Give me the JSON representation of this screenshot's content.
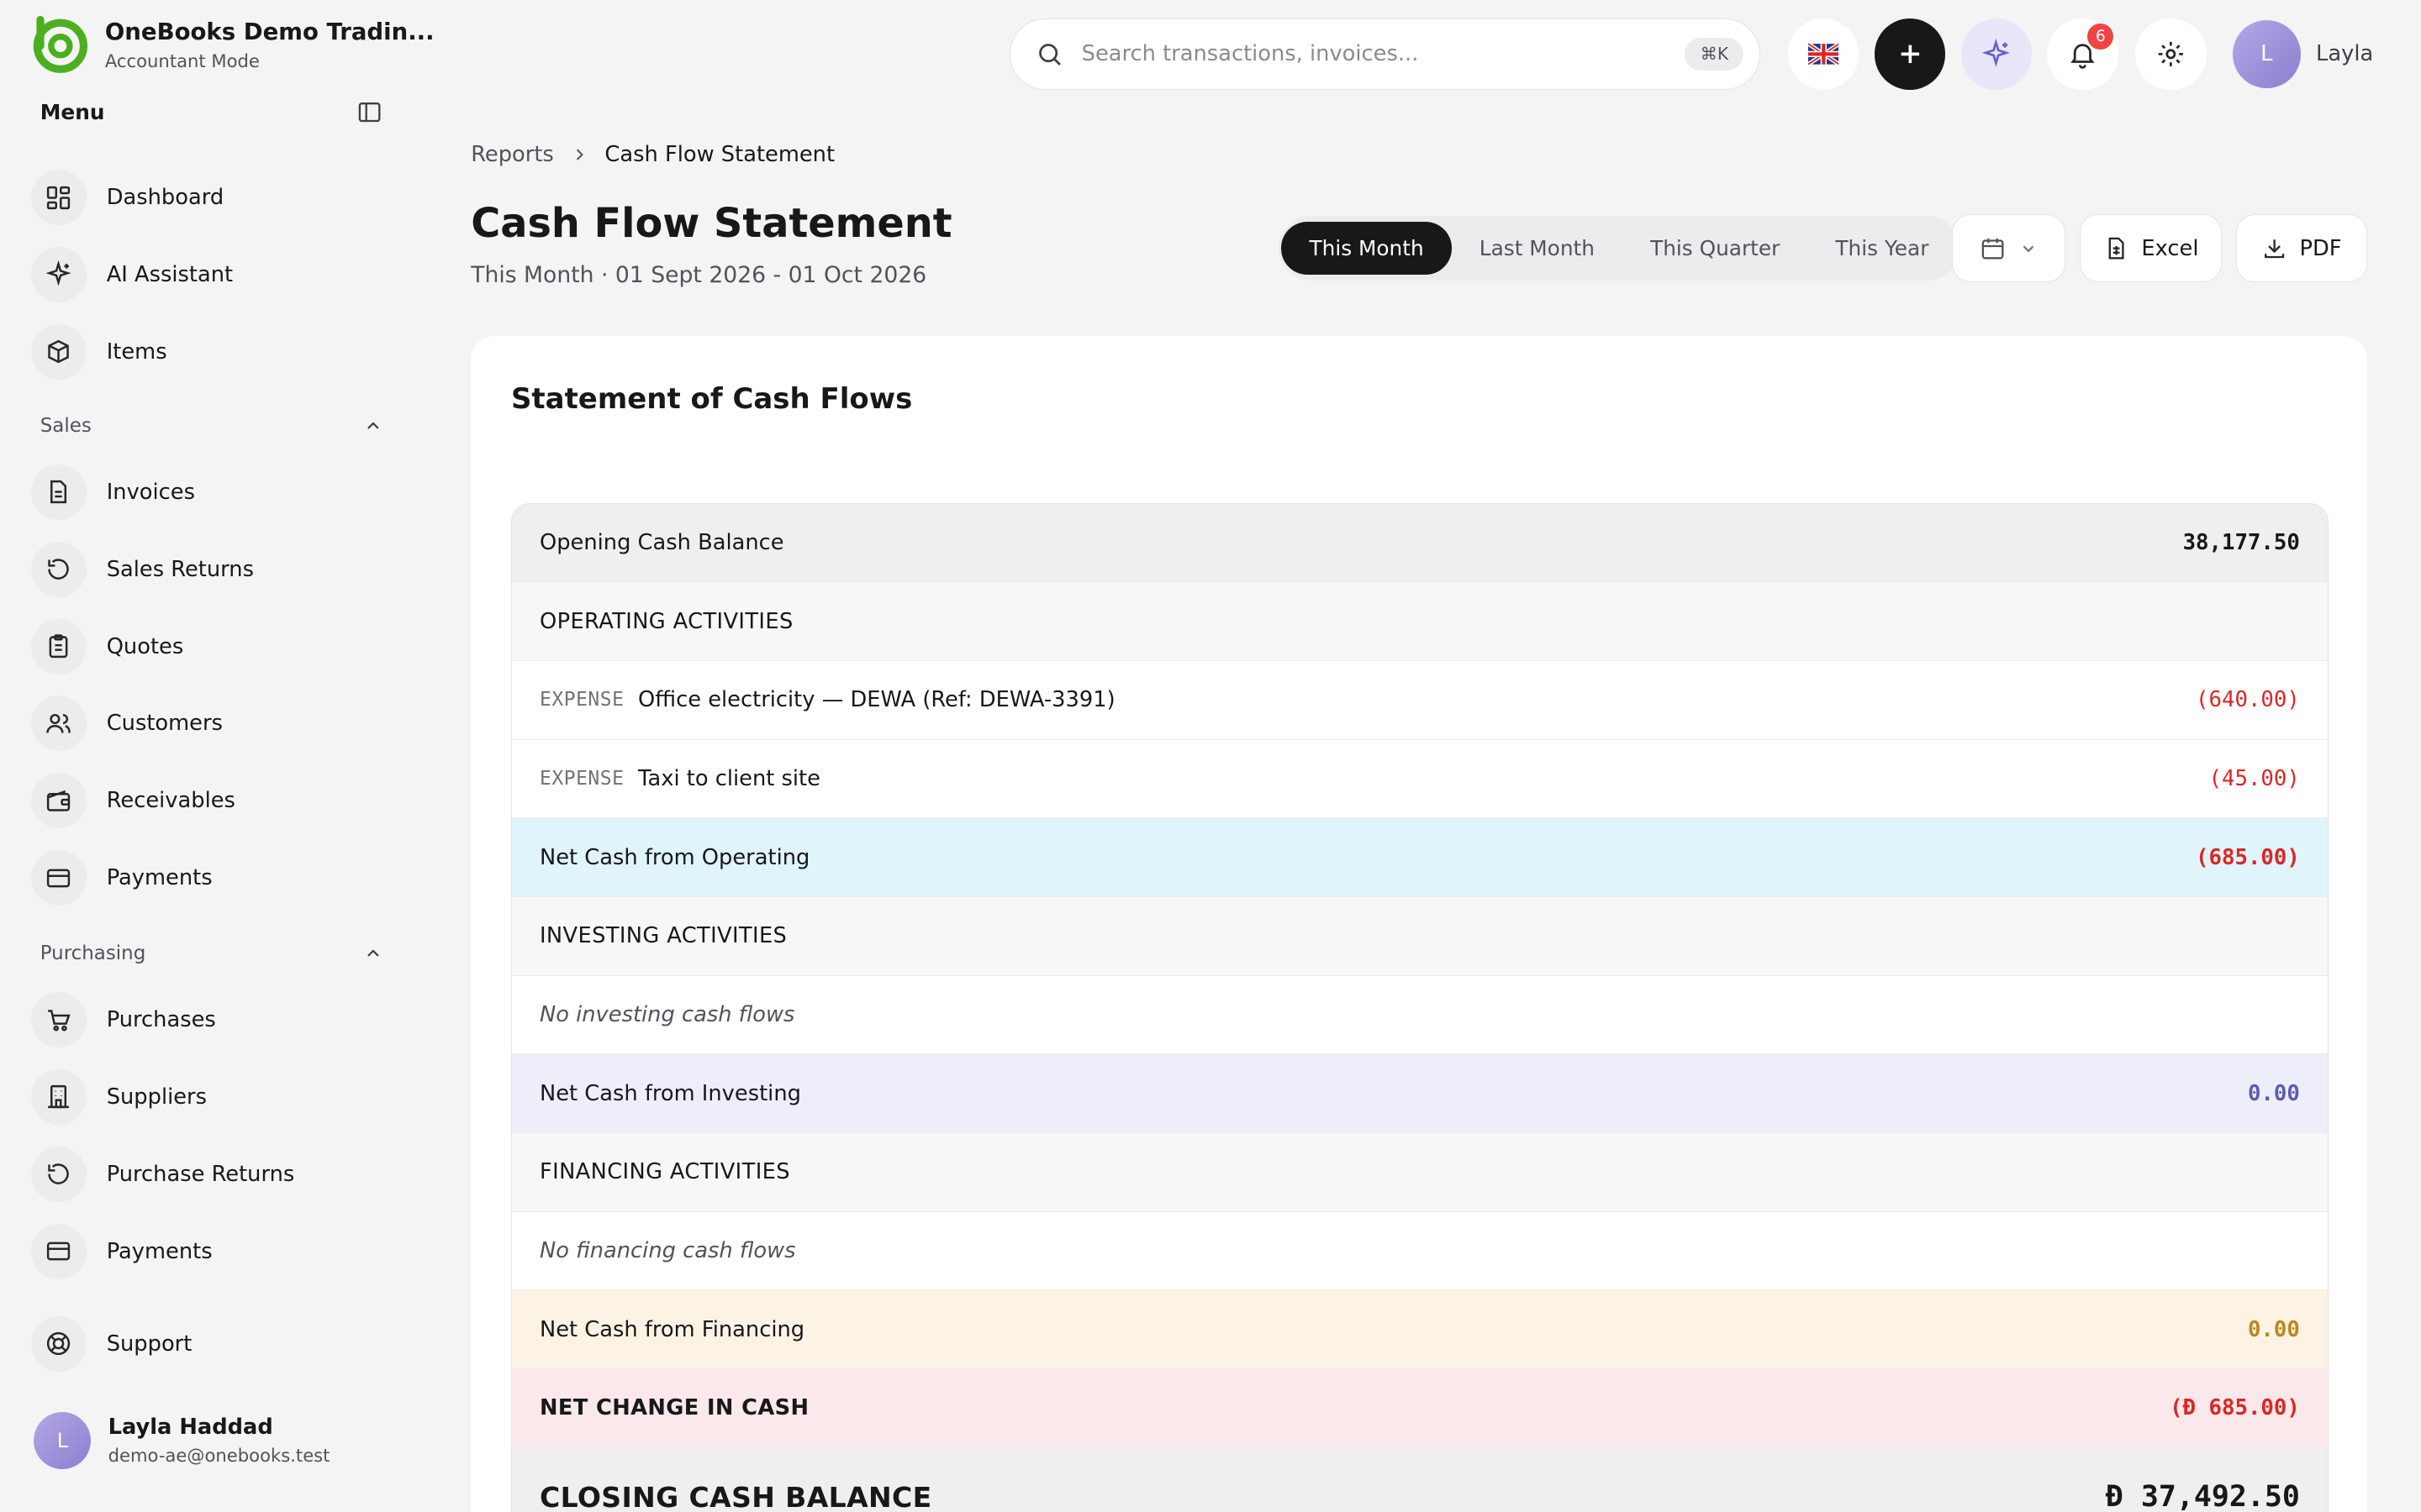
{
  "app": {
    "name": "OneBooks Demo Tradin...",
    "mode": "Accountant Mode"
  },
  "sidebar": {
    "menu_title": "Menu",
    "top_items": [
      {
        "label": "Dashboard",
        "icon": "dashboard-icon"
      },
      {
        "label": "AI Assistant",
        "icon": "sparkles-icon"
      },
      {
        "label": "Items",
        "icon": "box-icon"
      }
    ],
    "sales": {
      "title": "Sales",
      "items": [
        {
          "label": "Invoices",
          "icon": "file-icon"
        },
        {
          "label": "Sales Returns",
          "icon": "rotate-icon"
        },
        {
          "label": "Quotes",
          "icon": "clipboard-icon"
        },
        {
          "label": "Customers",
          "icon": "users-icon"
        },
        {
          "label": "Receivables",
          "icon": "wallet-icon"
        },
        {
          "label": "Payments",
          "icon": "card-icon"
        }
      ]
    },
    "purchasing": {
      "title": "Purchasing",
      "items": [
        {
          "label": "Purchases",
          "icon": "cart-icon"
        },
        {
          "label": "Suppliers",
          "icon": "building-icon"
        },
        {
          "label": "Purchase Returns",
          "icon": "rotate-icon"
        },
        {
          "label": "Payments",
          "icon": "card-icon"
        }
      ]
    },
    "support_label": "Support",
    "user": {
      "initial": "L",
      "name": "Layla Haddad",
      "email": "demo-ae@onebooks.test"
    }
  },
  "topbar": {
    "search_placeholder": "Search transactions, invoices...",
    "shortcut": "⌘K",
    "notification_count": "6",
    "user_initial": "L",
    "user_name": "Layla"
  },
  "breadcrumb": {
    "parent": "Reports",
    "current": "Cash Flow Statement"
  },
  "page": {
    "title": "Cash Flow Statement",
    "subtitle": "This Month · 01 Sept 2026 - 01 Oct 2026"
  },
  "period_tabs": [
    "This Month",
    "Last Month",
    "This Quarter",
    "This Year"
  ],
  "active_period": "This Month",
  "actions": {
    "excel": "Excel",
    "pdf": "PDF"
  },
  "report": {
    "title": "Statement of Cash Flows",
    "opening": {
      "label": "Opening Cash Balance",
      "amount": "38,177.50"
    },
    "operating": {
      "header": "OPERATING ACTIVITIES",
      "lines": [
        {
          "tag": "EXPENSE",
          "label": "Office electricity — DEWA (Ref: DEWA-3391)",
          "amount": "(640.00)"
        },
        {
          "tag": "EXPENSE",
          "label": "Taxi to client site",
          "amount": "(45.00)"
        }
      ],
      "net_label": "Net Cash from Operating",
      "net_amount": "(685.00)"
    },
    "investing": {
      "header": "INVESTING ACTIVITIES",
      "empty": "No investing cash flows",
      "net_label": "Net Cash from Investing",
      "net_amount": "0.00"
    },
    "financing": {
      "header": "FINANCING ACTIVITIES",
      "empty": "No financing cash flows",
      "net_label": "Net Cash from Financing",
      "net_amount": "0.00"
    },
    "net_change": {
      "label": "NET CHANGE IN CASH",
      "currency": "Đ",
      "amount": "(Đ 685.00)"
    },
    "closing": {
      "label": "CLOSING CASH BALANCE",
      "amount": "Đ 37,492.50"
    }
  },
  "colors": {
    "negative": "#dc2626",
    "operating_bg": "#e0f4fb",
    "investing_bg": "#eeeefb",
    "financing_bg": "#fdf3e4",
    "net_change_bg": "#fbe8ea",
    "section_bg": "#f7f7f8",
    "opening_bg": "#efeff1",
    "investing_value": "#5b5bb5",
    "financing_value": "#c0861a",
    "brand_green": "#4caf1f"
  }
}
